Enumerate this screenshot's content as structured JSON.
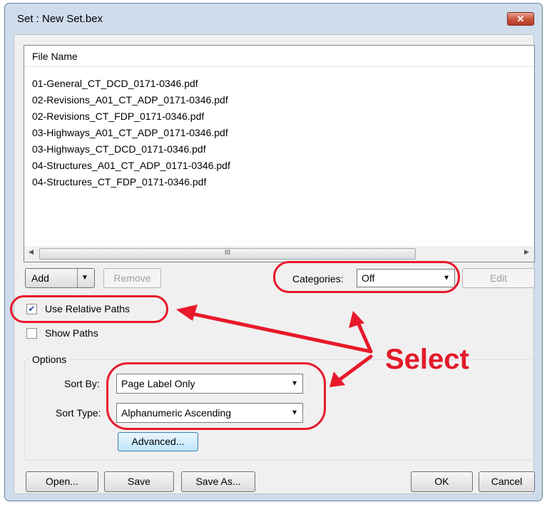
{
  "window": {
    "title": "Set : New Set.bex",
    "close_glyph": "✕"
  },
  "file_list": {
    "column_header": "File Name",
    "files": [
      "01-General_CT_DCD_0171-0346.pdf",
      "02-Revisions_A01_CT_ADP_0171-0346.pdf",
      "02-Revisions_CT_FDP_0171-0346.pdf",
      "03-Highways_A01_CT_ADP_0171-0346.pdf",
      "03-Highways_CT_DCD_0171-0346.pdf",
      "04-Structures_A01_CT_ADP_0171-0346.pdf",
      "04-Structures_CT_FDP_0171-0346.pdf"
    ],
    "scroll_thumb_grip": "III"
  },
  "toolbar": {
    "add_label": "Add",
    "remove_label": "Remove",
    "categories_label": "Categories:",
    "categories_value": "Off",
    "edit_label": "Edit"
  },
  "checkboxes": {
    "use_relative_paths": {
      "label": "Use Relative Paths",
      "checked": true
    },
    "show_paths": {
      "label": "Show Paths",
      "checked": false
    }
  },
  "options": {
    "group_label": "Options",
    "sort_by_label": "Sort By:",
    "sort_by_value": "Page Label Only",
    "sort_type_label": "Sort Type:",
    "sort_type_value": "Alphanumeric Ascending",
    "advanced_label": "Advanced..."
  },
  "footer": {
    "open_label": "Open...",
    "save_label": "Save",
    "save_as_label": "Save As...",
    "ok_label": "OK",
    "cancel_label": "Cancel"
  },
  "annotation": {
    "select_text": "Select",
    "color": "#e31a28"
  }
}
